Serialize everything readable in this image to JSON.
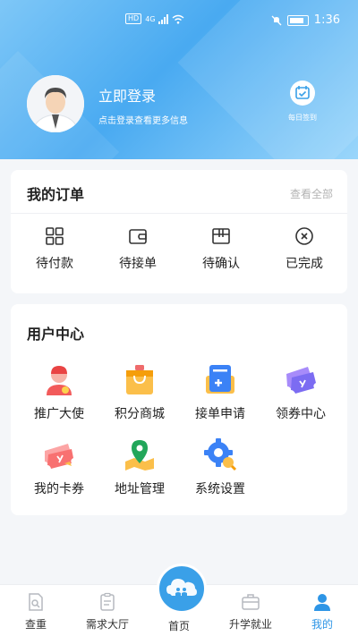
{
  "status_bar": {
    "network": "4G",
    "hd": "HD",
    "time": "1:36"
  },
  "header": {
    "login_title": "立即登录",
    "login_subtitle": "点击登录查看更多信息",
    "checkin_label": "每日签到"
  },
  "orders": {
    "title": "我的订单",
    "view_all": "查看全部",
    "items": [
      {
        "label": "待付款",
        "icon": "grid-icon"
      },
      {
        "label": "待接单",
        "icon": "wallet-icon"
      },
      {
        "label": "待确认",
        "icon": "box-icon"
      },
      {
        "label": "已完成",
        "icon": "circle-x-icon"
      }
    ]
  },
  "user_center": {
    "title": "用户中心",
    "items": [
      {
        "label": "推广大使",
        "icon": "ambassador-icon"
      },
      {
        "label": "积分商城",
        "icon": "shopping-bag-icon"
      },
      {
        "label": "接单申请",
        "icon": "application-icon"
      },
      {
        "label": "领券中心",
        "icon": "coupon-icon"
      },
      {
        "label": "我的卡券",
        "icon": "card-voucher-icon"
      },
      {
        "label": "地址管理",
        "icon": "location-pin-icon"
      },
      {
        "label": "系统设置",
        "icon": "gear-icon"
      }
    ]
  },
  "tabbar": {
    "items": [
      {
        "label": "查重",
        "icon": "doc-search-icon"
      },
      {
        "label": "需求大厅",
        "icon": "clipboard-icon"
      },
      {
        "label": "首页",
        "icon": "home-cloud-icon"
      },
      {
        "label": "升学就业",
        "icon": "briefcase-icon"
      },
      {
        "label": "我的",
        "icon": "person-icon"
      }
    ],
    "active_color": "#2d95e6"
  },
  "colors": {
    "header_blue": "#49aaf1",
    "accent": "#2d95e6"
  }
}
